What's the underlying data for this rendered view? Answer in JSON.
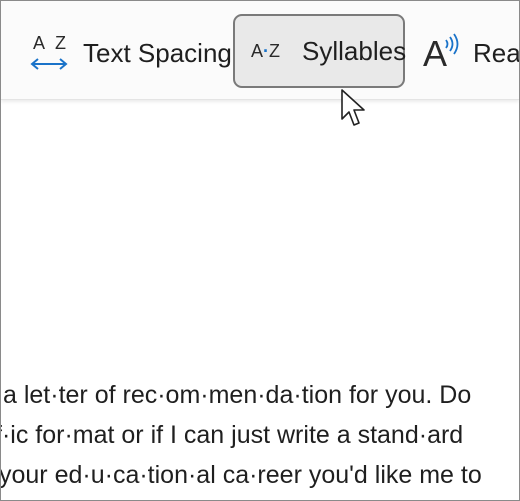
{
  "toolbar": {
    "text_spacing": {
      "icon_letters": "A Z",
      "label": "Text Spacing"
    },
    "syllables": {
      "icon_left": "A",
      "icon_dot": "·",
      "icon_right": "Z",
      "label": "Syllables",
      "selected": true
    },
    "read_aloud": {
      "icon_letter": "A",
      "label": "Read"
    }
  },
  "document": {
    "lines": [
      "a let·ter of rec·om·men·da·tion for you. Do",
      "f·ic for·mat or if I can just write a stand·ard",
      "your ed·u·ca·tion·al ca·reer you'd like me to"
    ]
  },
  "colors": {
    "accent": "#1a73c9",
    "selected_bg": "#e9e9e9",
    "selected_border": "#7a7a7a"
  }
}
